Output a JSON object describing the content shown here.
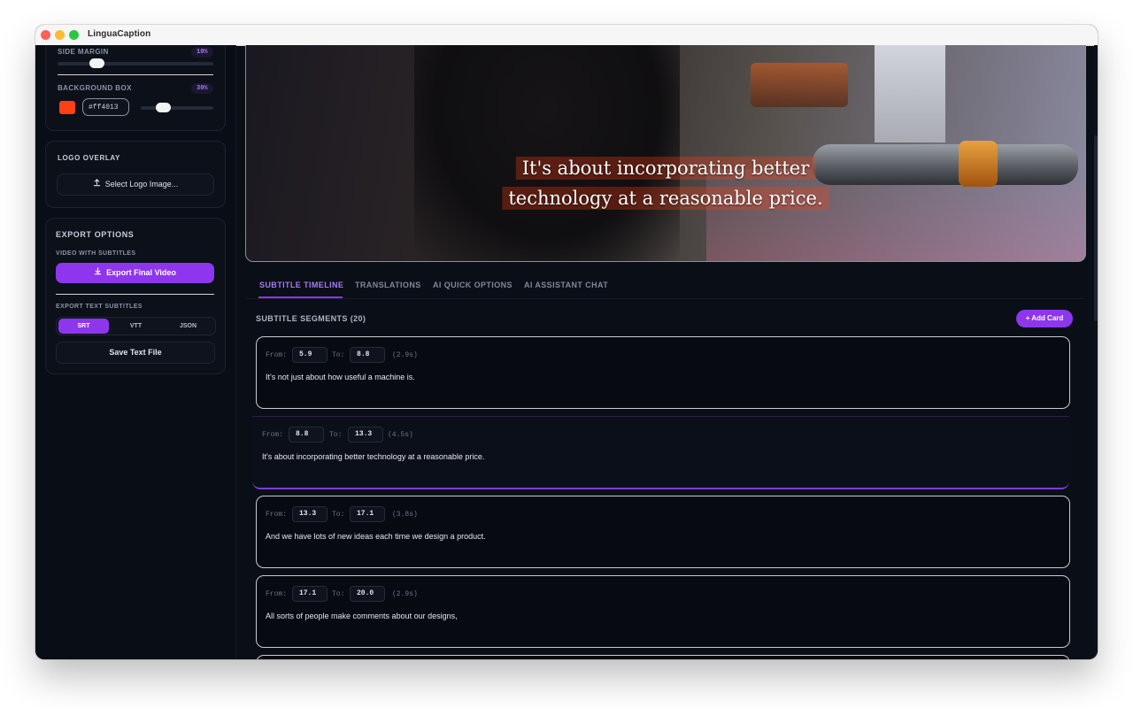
{
  "window": {
    "title": "LinguaCaption"
  },
  "sidebar": {
    "side_margin": {
      "label": "SIDE MARGIN",
      "value_label": "10%",
      "value": 0.1
    },
    "background_box": {
      "label": "BACKGROUND BOX",
      "color": "#ff4013",
      "hex_value": "#ff4013",
      "opacity_label": "30%",
      "opacity": 0.3
    },
    "logo_overlay": {
      "title": "LOGO OVERLAY",
      "button": "Select Logo Image..."
    },
    "export": {
      "title": "EXPORT OPTIONS",
      "video_label": "VIDEO WITH SUBTITLES",
      "export_button": "Export Final Video",
      "text_label": "EXPORT TEXT SUBTITLES",
      "formats": [
        "SRT",
        "VTT",
        "JSON"
      ],
      "selected_format": "SRT",
      "save_button": "Save Text File"
    }
  },
  "video": {
    "caption_lines": [
      "It's about incorporating better",
      "technology at a reasonable price."
    ]
  },
  "tabs": [
    "SUBTITLE TIMELINE",
    "TRANSLATIONS",
    "AI QUICK OPTIONS",
    "AI ASSISTANT CHAT"
  ],
  "active_tab": "SUBTITLE TIMELINE",
  "segments": {
    "title": "SUBTITLE SEGMENTS (20)",
    "add_button": "+ Add Card",
    "from_label": "From:",
    "to_label": "To:",
    "items": [
      {
        "from": "5.9",
        "to": "8.8",
        "duration": "(2.9s)",
        "text": "It's not just about how useful a machine is."
      },
      {
        "from": "8.8",
        "to": "13.3",
        "duration": "(4.5s)",
        "text": "It's about incorporating better technology at a reasonable price."
      },
      {
        "from": "13.3",
        "to": "17.1",
        "duration": "(3.8s)",
        "text": "And we have lots of new ideas each time we design a product."
      },
      {
        "from": "17.1",
        "to": "20.0",
        "duration": "(2.9s)",
        "text": "All sorts of people make comments about our designs,"
      }
    ]
  },
  "colors": {
    "accent": "#8e36ee",
    "accent_text": "#a77af6",
    "background": "#0a0e17"
  }
}
